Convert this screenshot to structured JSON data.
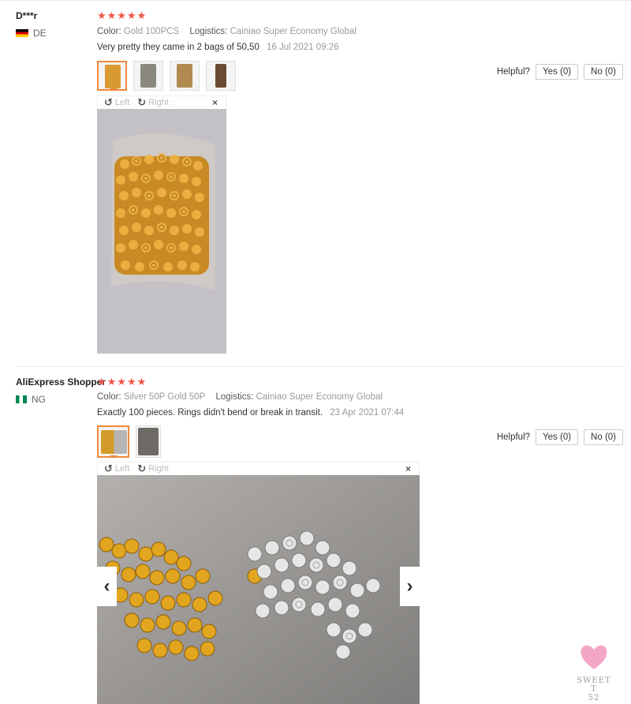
{
  "reviews": [
    {
      "name": "D***r",
      "country": "DE",
      "stars": "★★★★★",
      "color_label": "Color:",
      "color_value": "Gold 100PCS",
      "logistics_label": "Logistics:",
      "logistics_value": "Cainiao Super Economy Global",
      "text": "Very pretty they came in 2 bags of 50,50",
      "date": "16 Jul 2021 09:26",
      "helpful_label": "Helpful?",
      "yes_label": "Yes (0)",
      "no_label": "No (0)",
      "viewer": {
        "left_label": "Left",
        "right_label": "Right",
        "close": "×"
      }
    },
    {
      "name": "AliExpress Shopper",
      "country": "NG",
      "stars": "★★★★★",
      "color_label": "Color:",
      "color_value": "Silver 50P Gold 50P",
      "logistics_label": "Logistics:",
      "logistics_value": "Cainiao Super Economy Global",
      "text": "Exactly 100 pieces. Rings didn't bend or break in transit.",
      "date": "23 Apr 2021 07:44",
      "helpful_label": "Helpful?",
      "yes_label": "Yes (0)",
      "no_label": "No (0)",
      "viewer": {
        "left_label": "Left",
        "right_label": "Right",
        "close": "×",
        "prev": "‹",
        "next": "›"
      }
    }
  ],
  "watermark": {
    "line1": "SWEET T",
    "line2": "52"
  },
  "colors": {
    "star": "#f05548",
    "accent": "#f08a3a",
    "gold": "#e0a020",
    "silver": "#c8c8c8"
  }
}
